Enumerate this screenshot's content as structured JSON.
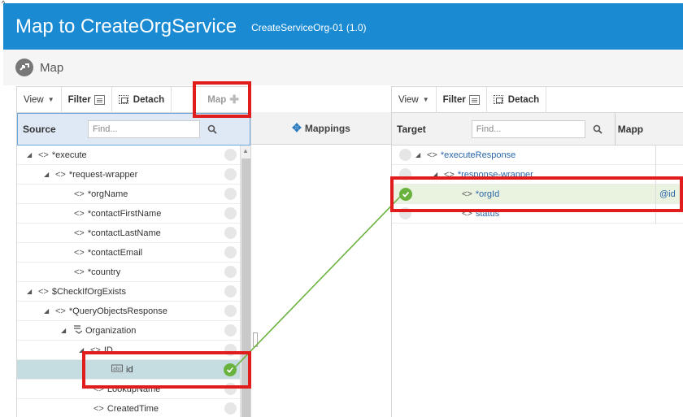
{
  "page": {
    "title": "Map to CreateOrgService",
    "subtitle": "CreateServiceOrg-01 (1.0)",
    "section_label": "Map"
  },
  "left": {
    "toolbar": {
      "view": "View",
      "filter": "Filter",
      "detach": "Detach",
      "map": "Map"
    },
    "header": "Source",
    "search_placeholder": "Find...",
    "rows": [
      {
        "label": "*execute",
        "tag": "<>"
      },
      {
        "label": "*request-wrapper",
        "tag": "<>"
      },
      {
        "label": "*orgName",
        "tag": "<>"
      },
      {
        "label": "*contactFirstName",
        "tag": "<>"
      },
      {
        "label": "*contactLastName",
        "tag": "<>"
      },
      {
        "label": "*contactEmail",
        "tag": "<>"
      },
      {
        "label": "*country",
        "tag": "<>"
      },
      {
        "label": "$CheckIfOrgExists",
        "tag": "<>"
      },
      {
        "label": "*QueryObjectsResponse",
        "tag": "<>"
      },
      {
        "label": "Organization",
        "tag": ""
      },
      {
        "label": "ID",
        "tag": "<>"
      },
      {
        "label": "id",
        "tag": ""
      },
      {
        "label": "LookupName",
        "tag": "<>"
      },
      {
        "label": "CreatedTime",
        "tag": "<>"
      }
    ]
  },
  "middle": {
    "header": "Mappings"
  },
  "right": {
    "toolbar": {
      "view": "View",
      "filter": "Filter",
      "detach": "Detach"
    },
    "header": "Target",
    "search_placeholder": "Find...",
    "mapping_col": "Mapp",
    "rows": [
      {
        "label": "*executeResponse",
        "tag": "<>",
        "mapping": ""
      },
      {
        "label": "*response-wrapper",
        "tag": "<>",
        "mapping": ""
      },
      {
        "label": "*orgId",
        "tag": "<>",
        "mapping": "@id"
      },
      {
        "label": "status",
        "tag": "<>",
        "mapping": ""
      }
    ]
  },
  "colors": {
    "header_blue": "#1a8bd3",
    "highlight_red": "#e01c1c",
    "mapped_green": "#6ab23e"
  }
}
